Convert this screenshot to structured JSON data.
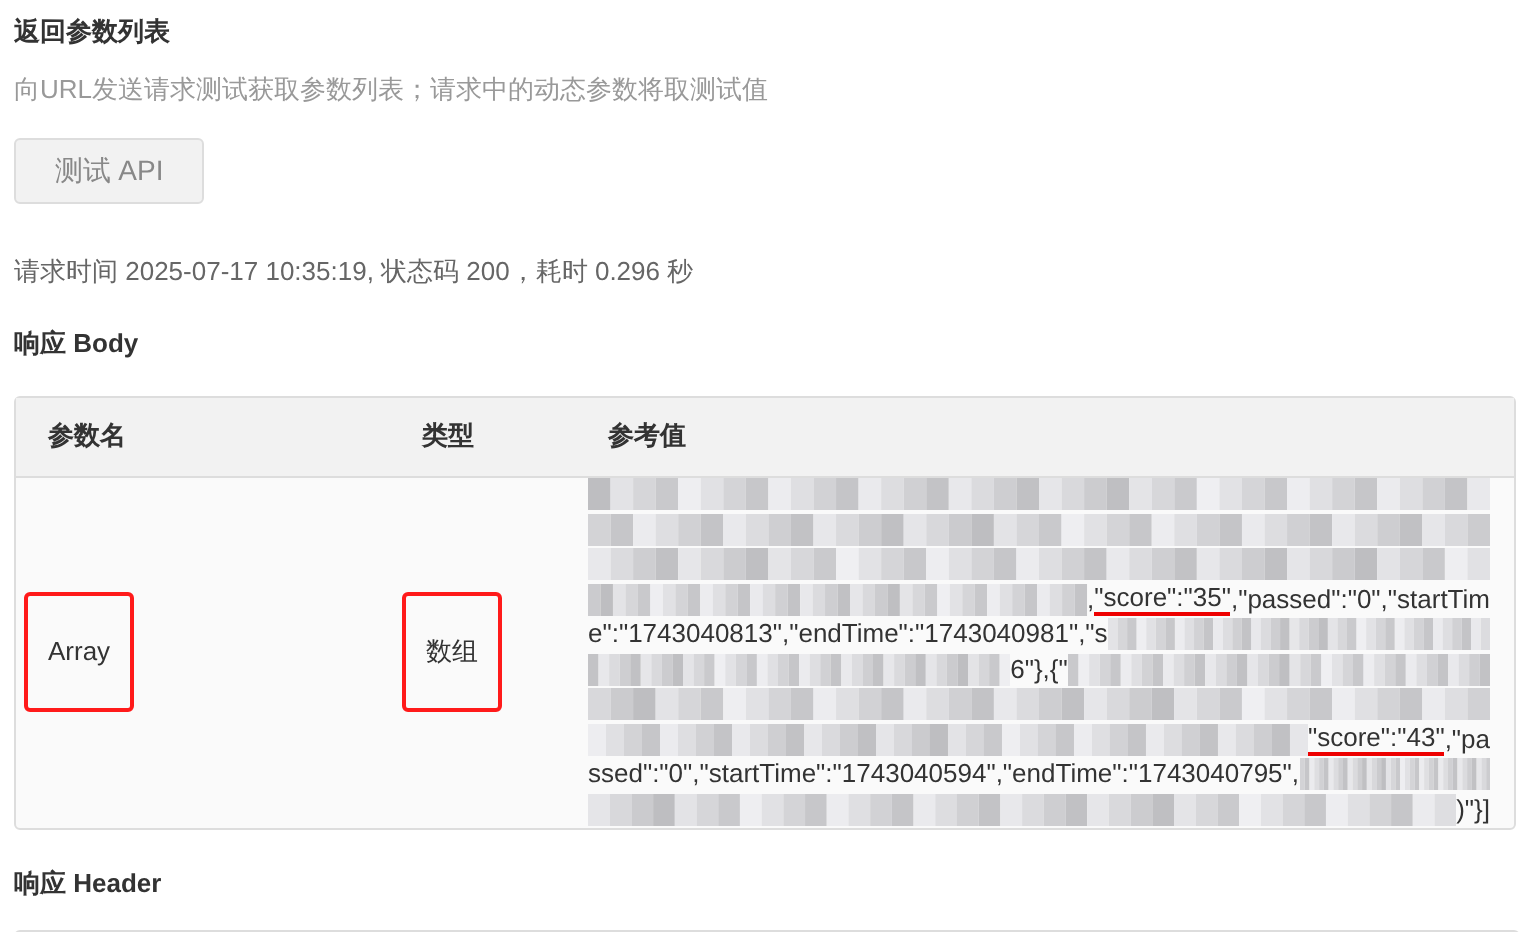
{
  "section": {
    "title": "返回参数列表",
    "description": "向URL发送请求测试获取参数列表；请求中的动态参数将取测试值"
  },
  "test_button": "测试 API",
  "request_info": "请求时间 2025-07-17 10:35:19, 状态码 200，耗时 0.296 秒",
  "body": {
    "title": "响应 Body",
    "columns": [
      "参数名",
      "类型",
      "参考值"
    ],
    "rows": [
      {
        "name": {
          "text": "Array",
          "highlighted": true
        },
        "type": {
          "text": "数组",
          "highlighted": true
        },
        "value_lines": [
          [
            {
              "kind": "redacted"
            }
          ],
          [
            {
              "kind": "redacted"
            }
          ],
          [
            {
              "kind": "redacted"
            }
          ],
          [
            {
              "kind": "redacted"
            },
            {
              "kind": "text",
              "text": ",",
              "underlined": false
            },
            {
              "kind": "text",
              "text": "\"score\":\"35\"",
              "underlined": true
            },
            {
              "kind": "text",
              "text": ",\"passed\":\"0\",\"startTim",
              "underlined": false
            }
          ],
          [
            {
              "kind": "text",
              "text": "e\":\"1743040813\",\"endTime\":\"1743040981\",\"s",
              "underlined": false
            },
            {
              "kind": "redacted"
            }
          ],
          [
            {
              "kind": "redacted"
            },
            {
              "kind": "text",
              "text": "6\"},{\"",
              "underlined": false
            },
            {
              "kind": "redacted"
            }
          ],
          [
            {
              "kind": "redacted"
            }
          ],
          [
            {
              "kind": "redacted"
            },
            {
              "kind": "text",
              "text": "\"score\":\"43\"",
              "underlined": true
            },
            {
              "kind": "text",
              "text": ",\"pa",
              "underlined": false
            }
          ],
          [
            {
              "kind": "text",
              "text": "ssed\":\"0\",\"startTime\":\"1743040594\",\"endTime\":\"1743040795\",",
              "underlined": false
            },
            {
              "kind": "redacted"
            }
          ],
          [
            {
              "kind": "redacted"
            },
            {
              "kind": "text",
              "text": ")\"}]",
              "underlined": false
            }
          ]
        ]
      }
    ]
  },
  "header": {
    "title": "响应 Header"
  }
}
